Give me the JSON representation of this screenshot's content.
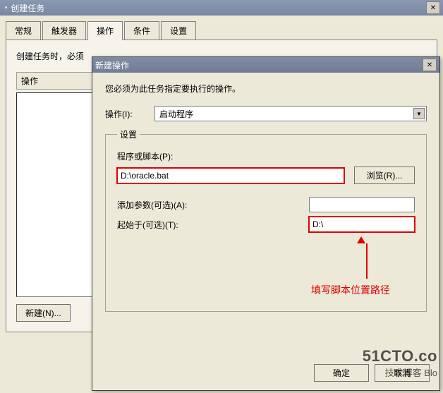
{
  "window": {
    "title": "创建任务",
    "close_glyph": "✕"
  },
  "tabs": [
    "常规",
    "触发器",
    "操作",
    "条件",
    "设置"
  ],
  "active_tab_index": 2,
  "main": {
    "hint_prefix": "创建任务时，必须",
    "list_header": "操作",
    "new_button": "新建(N)..."
  },
  "dialog": {
    "title": "新建操作",
    "close_glyph": "✕",
    "instruction": "您必须为此任务指定要执行的操作。",
    "action_label": "操作(I):",
    "action_value": "启动程序",
    "fieldset_legend": "设置",
    "program_label": "程序或脚本(P):",
    "program_value": "D:\\oracle.bat",
    "browse_button": "浏览(R)...",
    "args_label": "添加参数(可选)(A):",
    "args_value": "",
    "startin_label": "起始于(可选)(T):",
    "startin_value": "D:\\",
    "annotation": "填写脚本位置路径",
    "ok_button": "确定",
    "cancel_button": "取消"
  },
  "watermark": {
    "line1": "51CTO.co",
    "line2": "技术博客  Blo"
  }
}
